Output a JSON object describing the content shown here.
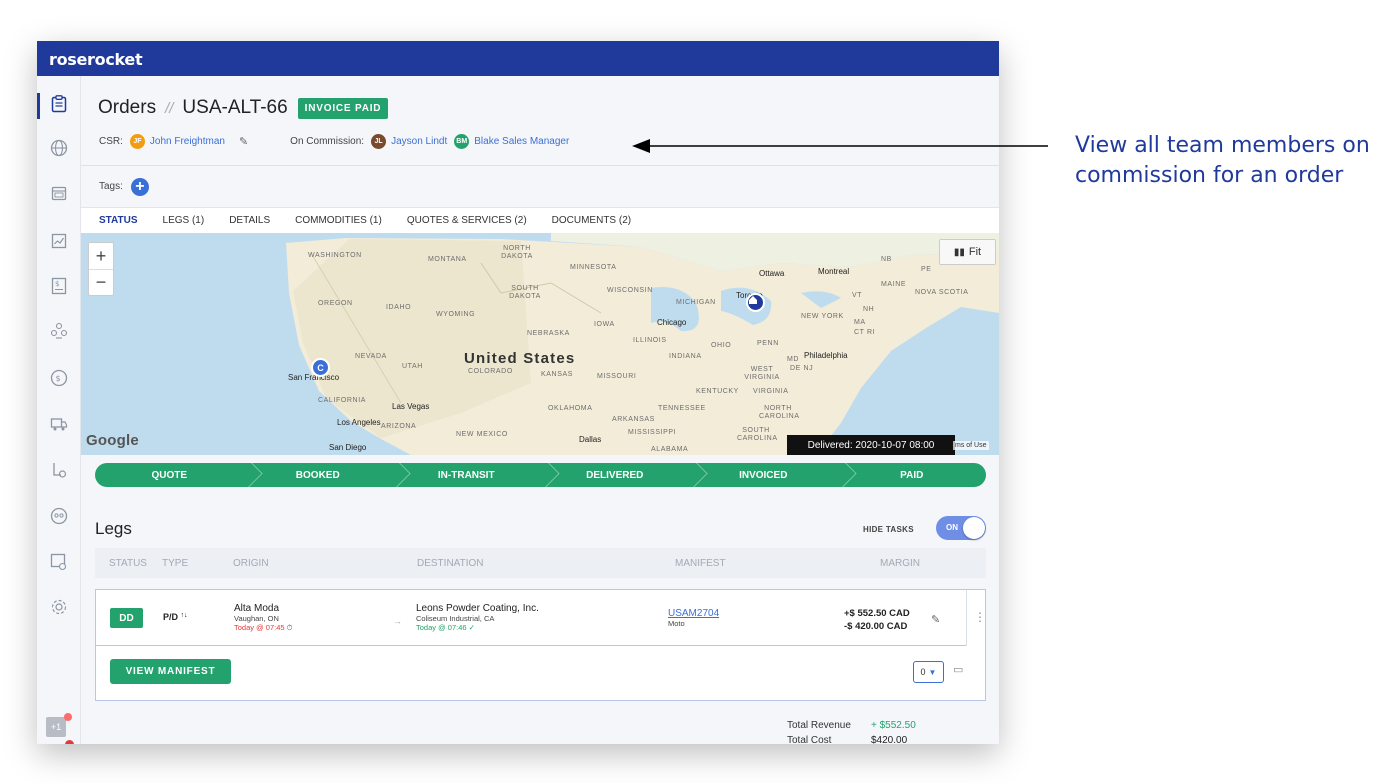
{
  "app": {
    "brand": "roserocket"
  },
  "header": {
    "title": "Orders",
    "separator": "//",
    "order_id": "USA-ALT-66",
    "status_badge": "INVOICE PAID",
    "csr_label": "CSR:",
    "csr": {
      "initials": "JF",
      "name": "John Freightman",
      "color": "#f39c12"
    },
    "commission_label": "On Commission:",
    "commission": [
      {
        "initials": "JL",
        "name": "Jayson Lindt",
        "color": "#7b4a2d"
      },
      {
        "initials": "BM",
        "name": "Blake Sales Manager",
        "color": "#23a26d"
      }
    ]
  },
  "tags": {
    "label": "Tags:",
    "add": "+"
  },
  "tabs": [
    {
      "label": "STATUS",
      "active": true
    },
    {
      "label": "LEGS (1)"
    },
    {
      "label": "DETAILS"
    },
    {
      "label": "COMMODITIES (1)"
    },
    {
      "label": "QUOTES & SERVICES (2)"
    },
    {
      "label": "DOCUMENTS (2)"
    }
  ],
  "map": {
    "zoom_in": "+",
    "zoom_out": "−",
    "fit_label": "Fit",
    "google": "Google",
    "delivered_tooltip": "Delivered: 2020-10-07 08:00",
    "terms": "ms of Use",
    "country": "United States",
    "regions": [
      "WASHINGTON",
      "MONTANA",
      "NORTH DAKOTA",
      "MINNESOTA",
      "OREGON",
      "IDAHO",
      "SOUTH DAKOTA",
      "WISCONSIN",
      "MICHIGAN",
      "WYOMING",
      "NEBRASKA",
      "IOWA",
      "ILLINOIS",
      "OHIO",
      "PENN",
      "NEVADA",
      "UTAH",
      "COLORADO",
      "KANSAS",
      "MISSOURI",
      "INDIANA",
      "KENTUCKY",
      "VIRGINIA",
      "CALIFORNIA",
      "ARIZONA",
      "NEW MEXICO",
      "OKLAHOMA",
      "ARKANSAS",
      "TENNESSEE",
      "NORTH CAROLINA",
      "SOUTH CAROLINA",
      "MISSISSIPPI",
      "ALABAMA",
      "MAINE",
      "NOVA SCOTIA",
      "NB",
      "PE",
      "VT",
      "NH",
      "MA",
      "CT RI",
      "NEW YORK",
      "WEST VIRGINIA",
      "MD",
      "DE NJ"
    ],
    "cities": [
      "Ottawa",
      "Montreal",
      "Chicago",
      "Philadelphia",
      "San Francisco",
      "Las Vegas",
      "Los Angeles",
      "San Diego",
      "Dallas",
      "Toronto"
    ],
    "pin_origin": "C",
    "pin_destination": "🏠"
  },
  "progress": [
    "QUOTE",
    "BOOKED",
    "IN-TRANSIT",
    "DELIVERED",
    "INVOICED",
    "PAID"
  ],
  "legs": {
    "title": "Legs",
    "hide_tasks_label": "HIDE TASKS",
    "toggle_label": "ON",
    "columns": [
      "STATUS",
      "TYPE",
      "ORIGIN",
      "DESTINATION",
      "MANIFEST",
      "MARGIN"
    ],
    "row": {
      "status": "DD",
      "type": "P/D",
      "origin_name": "Alta Moda",
      "origin_city": "Vaughan, ON",
      "origin_time": "Today @ 07:45",
      "destination_name": "Leons Powder Coating, Inc.",
      "destination_city": "Coliseum Industrial, CA",
      "destination_time": "Today @ 07:46",
      "manifest_id": "USAM2704",
      "manifest_carrier": "Moto",
      "revenue": "+$ 552.50 CAD",
      "cost": "-$ 420.00 CAD"
    },
    "view_manifest": "VIEW MANIFEST",
    "count_select": "0"
  },
  "totals": [
    {
      "label": "Total Revenue",
      "value": "+ $552.50"
    },
    {
      "label": "Total Cost",
      "value": "$420.00"
    }
  ],
  "annotation": "View all team members on commission for an order",
  "colors": {
    "brand": "#203a9c",
    "green": "#23a26d",
    "link": "#3b6fd8",
    "red": "#e53935"
  }
}
